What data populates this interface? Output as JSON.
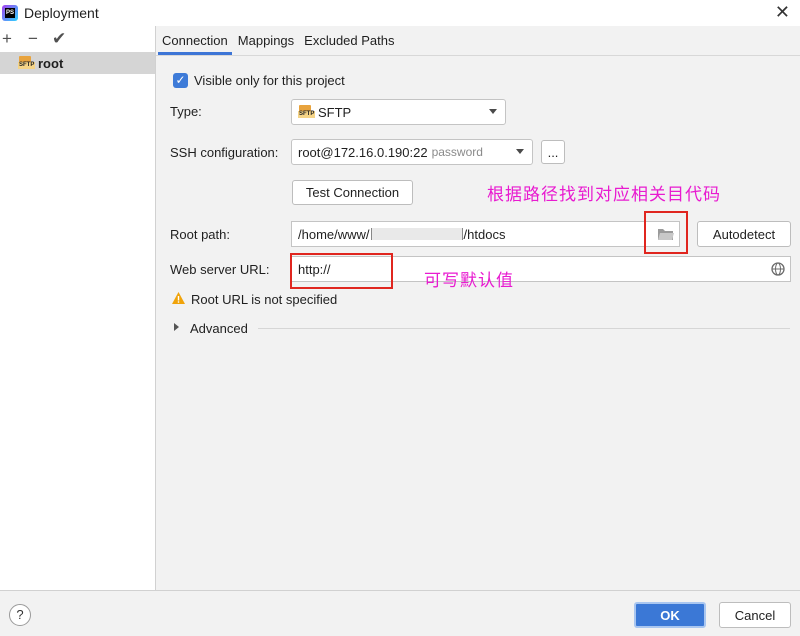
{
  "window": {
    "title": "Deployment",
    "close_icon": "close-icon",
    "app_icon_text": "PS"
  },
  "sidebar": {
    "toolbar": [
      "+",
      "−",
      "✔"
    ],
    "items": [
      {
        "label": "root",
        "icon": "sftp-server-icon",
        "icon_text": "SFTP",
        "selected": true
      }
    ]
  },
  "tabs": [
    {
      "label": "Connection",
      "active": true
    },
    {
      "label": "Mappings",
      "active": false
    },
    {
      "label": "Excluded Paths",
      "active": false
    }
  ],
  "connection": {
    "visible_only_label": "Visible only for this project",
    "visible_only_checked": true,
    "type_label": "Type:",
    "type_value": "SFTP",
    "type_icon_text": "SFTP",
    "ssh_label": "SSH configuration:",
    "ssh_value": "root@172.16.0.190:22",
    "ssh_auth": "password",
    "ssh_more": "...",
    "test_connection": "Test Connection",
    "root_path_label": "Root path:",
    "root_path_prefix": "/home/www/",
    "root_path_suffix": "/htdocs",
    "autodetect": "Autodetect",
    "web_url_label": "Web server URL:",
    "web_url_value": "http://",
    "warning": "Root URL is not specified",
    "advanced": "Advanced"
  },
  "annotations": {
    "root_path_note": "根据路径找到对应相关目代码",
    "url_note": "可写默认值",
    "color": "#e81bd0"
  },
  "footer": {
    "help": "?",
    "ok": "OK",
    "cancel": "Cancel"
  },
  "colors": {
    "accent": "#3b78d6",
    "warning": "#f0a30a",
    "highlight": "#e0261f"
  }
}
